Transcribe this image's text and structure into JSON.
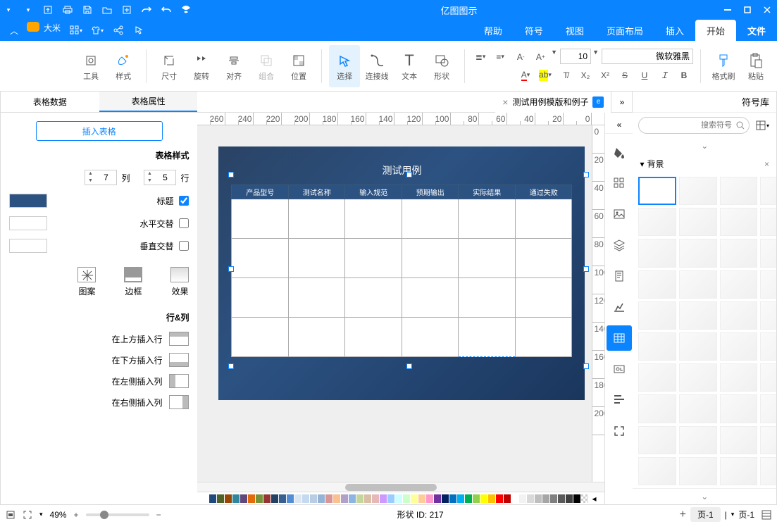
{
  "app": {
    "title": "亿图图示"
  },
  "menu": {
    "file": "文件",
    "items": [
      "开始",
      "插入",
      "页面布局",
      "视图",
      "符号",
      "帮助"
    ],
    "active_index": 0,
    "user": "大米"
  },
  "ribbon": {
    "paste": "粘贴",
    "fmt": "格式刷",
    "font_name": "微软雅黑",
    "font_size": "10",
    "select": "选择",
    "text": "文本",
    "lines": "连接线",
    "shape": "形状",
    "position": "位置",
    "align": "对齐",
    "rotate": "旋转",
    "size": "尺寸",
    "combine": "组合",
    "layer": "图层",
    "style": "样式",
    "tools": "工具"
  },
  "left": {
    "header": "符号库",
    "search_placeholder": "搜索符号",
    "section": "背景"
  },
  "doc": {
    "tab_label": "测试用例模版和例子",
    "title": "测试用例",
    "headers": [
      "产品型号",
      "测试名称",
      "输入规范",
      "预期输出",
      "实际结果",
      "通过失败"
    ]
  },
  "ruler_h": [
    "0",
    "20",
    "40",
    "60",
    "80",
    "100",
    "120",
    "140",
    "160",
    "180",
    "200",
    "220",
    "240",
    "260"
  ],
  "ruler_v": [
    "0",
    "20",
    "40",
    "60",
    "80",
    "100",
    "120",
    "140",
    "160",
    "180",
    "200"
  ],
  "right": {
    "tabs": [
      "表格属性",
      "表格数据"
    ],
    "insert": "插入表格",
    "style_hdr": "表格样式",
    "rows_label": "行",
    "cols_label": "列",
    "rows": "5",
    "cols": "7",
    "header_chk": "标题",
    "halt_chk": "水平交替",
    "valt_chk": "垂直交替",
    "effect": "效果",
    "border": "边框",
    "pattern": "图案",
    "rowcol_hdr": "行&列",
    "ops": [
      "在上方插入行",
      "在下方插入行",
      "在左侧插入列",
      "在右侧插入列"
    ]
  },
  "status": {
    "page_label": "页-1",
    "pages_drop": "页-1",
    "shape_id_label": "形状 ID:",
    "shape_id": "217",
    "zoom": "49%"
  },
  "colors": [
    "#000000",
    "#3f3f3f",
    "#595959",
    "#7f7f7f",
    "#a6a6a6",
    "#bfbfbf",
    "#d9d9d9",
    "#f2f2f2",
    "#ffffff",
    "#c00000",
    "#ff0000",
    "#ffc000",
    "#ffff00",
    "#92d050",
    "#00b050",
    "#00b0f0",
    "#0070c0",
    "#002060",
    "#7030a0",
    "#ff99cc",
    "#ffcc99",
    "#ffff99",
    "#ccffcc",
    "#ccffff",
    "#99ccff",
    "#cc99ff",
    "#e6b8b8",
    "#d9bfa6",
    "#c4d79b",
    "#8db4e2",
    "#b1a0c7",
    "#fac090",
    "#da9694",
    "#95b3d7",
    "#b8cce4",
    "#c5d9f1",
    "#dce6f1",
    "#538dd5",
    "#366092",
    "#244062",
    "#963634",
    "#76933c",
    "#e26b0a",
    "#60497a",
    "#31869b",
    "#974706",
    "#4f6228",
    "#1f497d"
  ]
}
